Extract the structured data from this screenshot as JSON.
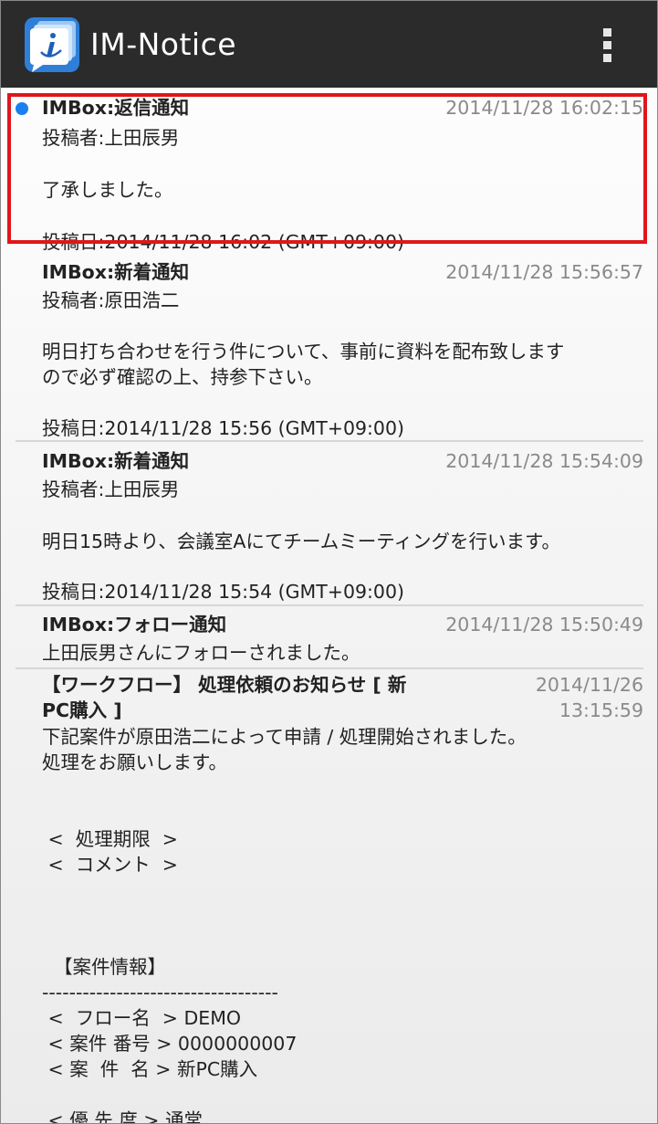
{
  "app": {
    "title": "IM-Notice",
    "icon": "im-notice-app-icon",
    "menu_icon": "overflow-menu-icon"
  },
  "notifications": [
    {
      "subject": "IMBox:返信通知",
      "date": "2014/11/28 16:02:15",
      "author": "投稿者:上田辰男",
      "message": "了承しました。",
      "posted": "投稿日:2014/11/28 16:02 (GMT+09:00)",
      "unread": true,
      "selected": true
    },
    {
      "subject": "IMBox:新着通知",
      "date": "2014/11/28 15:56:57",
      "author": "投稿者:原田浩二",
      "message_line1": "明日打ち合わせを行う件について、事前に資料を配布致しま",
      "message_line1b": "す",
      "message_line2": "ので必ず確認の上、持参下さい。",
      "posted": "投稿日:2014/11/28 15:56 (GMT+09:00)"
    },
    {
      "subject": "IMBox:新着通知",
      "date": "2014/11/28 15:54:09",
      "author": "投稿者:上田辰男",
      "message": "明日15時より、会議室Aにてチームミーティングを行います。",
      "posted": "投稿日:2014/11/28 15:54 (GMT+09:00)"
    },
    {
      "subject": "IMBox:フォロー通知",
      "date": "2014/11/28 15:50:49",
      "message": "上田辰男さんにフォローされました。"
    },
    {
      "subject_line1": "【ワークフロー】 処理依頼のお知らせ [ 新",
      "subject_line2": "PC購入 ]",
      "date_line1": "2014/11/26",
      "date_line2": "13:15:59",
      "body": [
        "下記案件が原田浩二によって申請 / 処理開始されました。",
        "処理をお願いします。",
        "",
        "",
        " <  処理期限  >",
        " <  コメント  >",
        "",
        "",
        "",
        "  【案件情報】",
        "-----------------------------------",
        " <  フロー名  > DEMO",
        " < 案件 番号 > 0000000007",
        " < 案  件  名 > 新PC購入",
        "",
        " < 優 先 度 > 通常"
      ]
    }
  ]
}
